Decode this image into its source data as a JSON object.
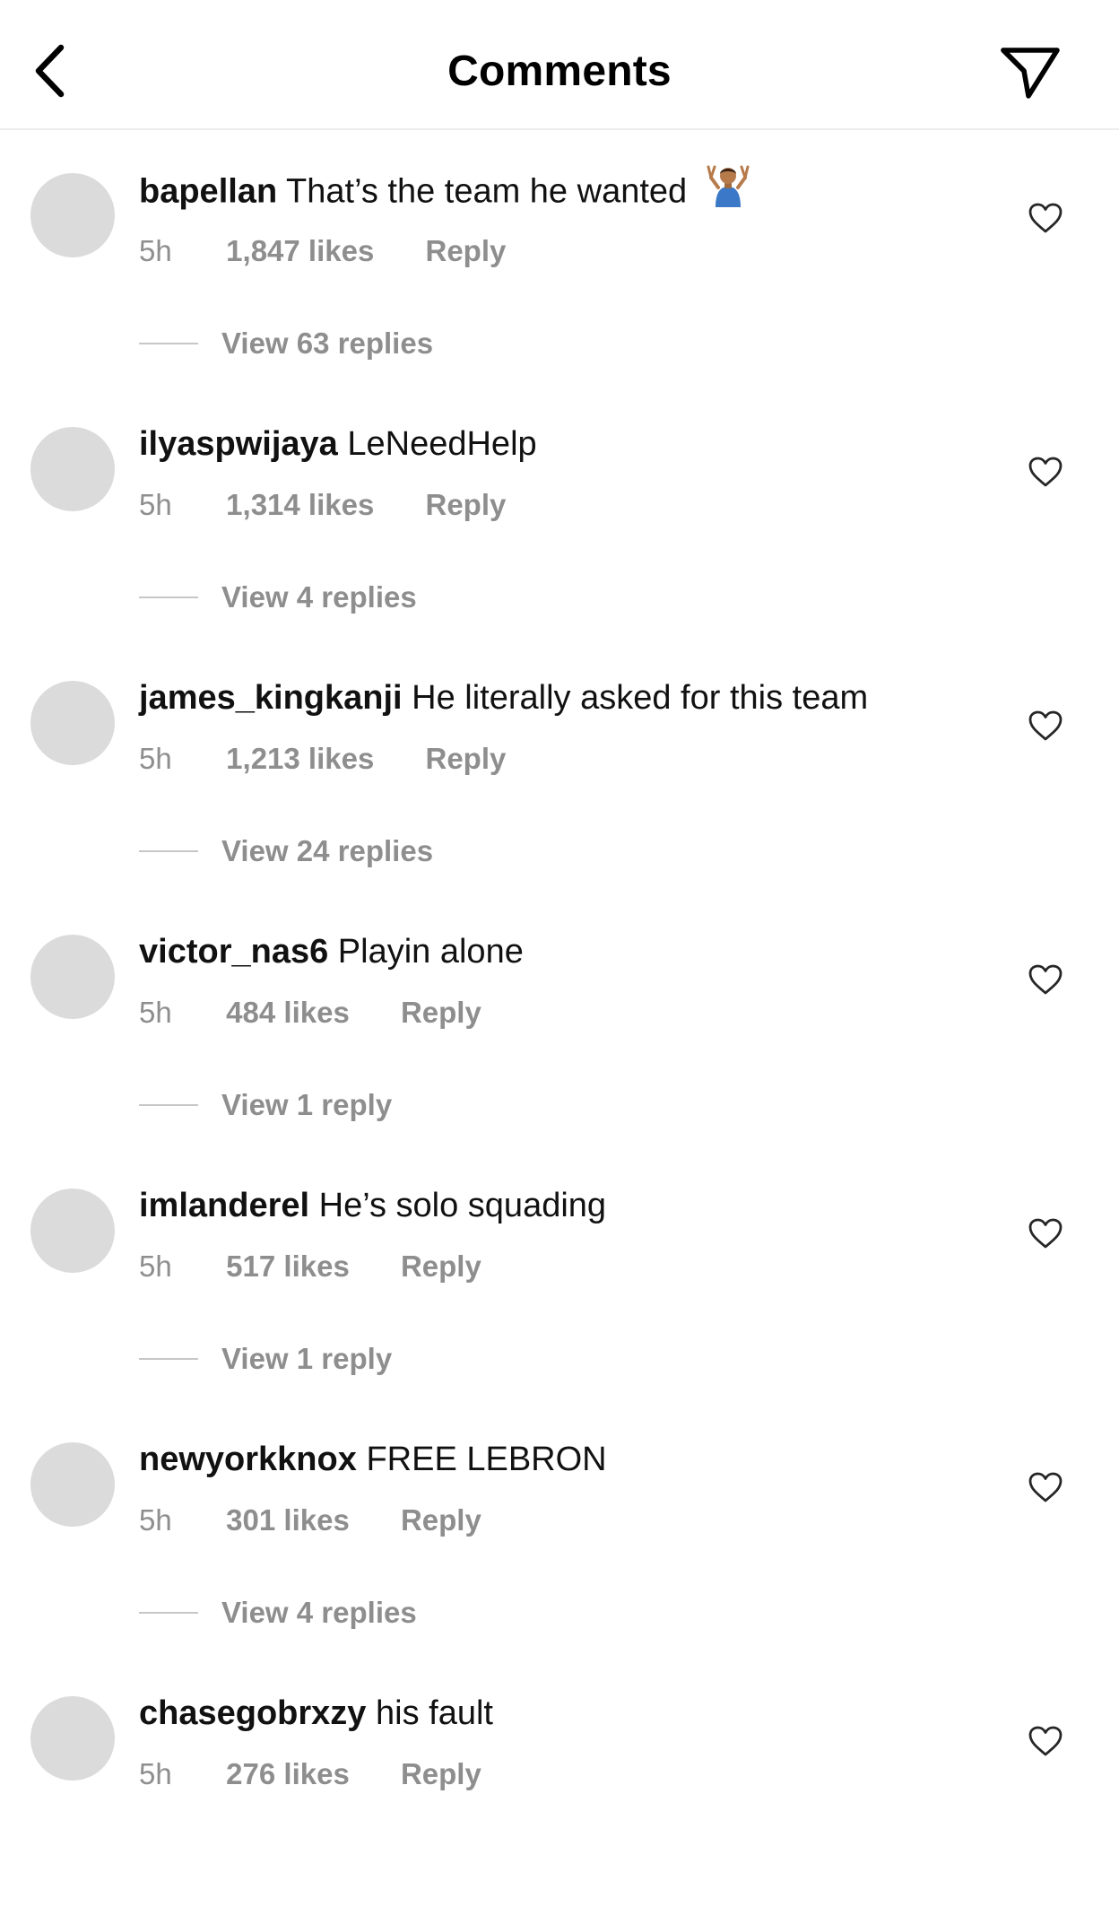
{
  "header": {
    "title": "Comments",
    "back_icon": "chevron-left-icon",
    "send_icon": "paper-plane-icon"
  },
  "colors": {
    "avatar_placeholder": "#dbdbdb",
    "secondary_text": "#8e8e8e",
    "divider": "#ececec"
  },
  "comments": [
    {
      "username": "bapellan",
      "text": "That’s the team he wanted",
      "emoji": "person-shrugging-emoji",
      "time": "5h",
      "likes": "1,847 likes",
      "reply": "Reply",
      "view_replies": "View 63 replies"
    },
    {
      "username": "ilyaspwijaya",
      "text": "LeNeedHelp",
      "time": "5h",
      "likes": "1,314 likes",
      "reply": "Reply",
      "view_replies": "View 4 replies"
    },
    {
      "username": "james_kingkanji",
      "text": "He literally asked for this team",
      "time": "5h",
      "likes": "1,213 likes",
      "reply": "Reply",
      "view_replies": "View 24 replies"
    },
    {
      "username": "victor_nas6",
      "text": "Playin alone",
      "time": "5h",
      "likes": "484 likes",
      "reply": "Reply",
      "view_replies": "View 1 reply"
    },
    {
      "username": "imlanderel",
      "text": "He’s solo squading",
      "time": "5h",
      "likes": "517 likes",
      "reply": "Reply",
      "view_replies": "View 1 reply"
    },
    {
      "username": "newyorkknox",
      "text": "FREE LEBRON",
      "time": "5h",
      "likes": "301 likes",
      "reply": "Reply",
      "view_replies": "View 4 replies"
    },
    {
      "username": "chasegobrxzy",
      "text": "his fault",
      "time": "5h",
      "likes": "276 likes",
      "reply": "Reply"
    }
  ]
}
